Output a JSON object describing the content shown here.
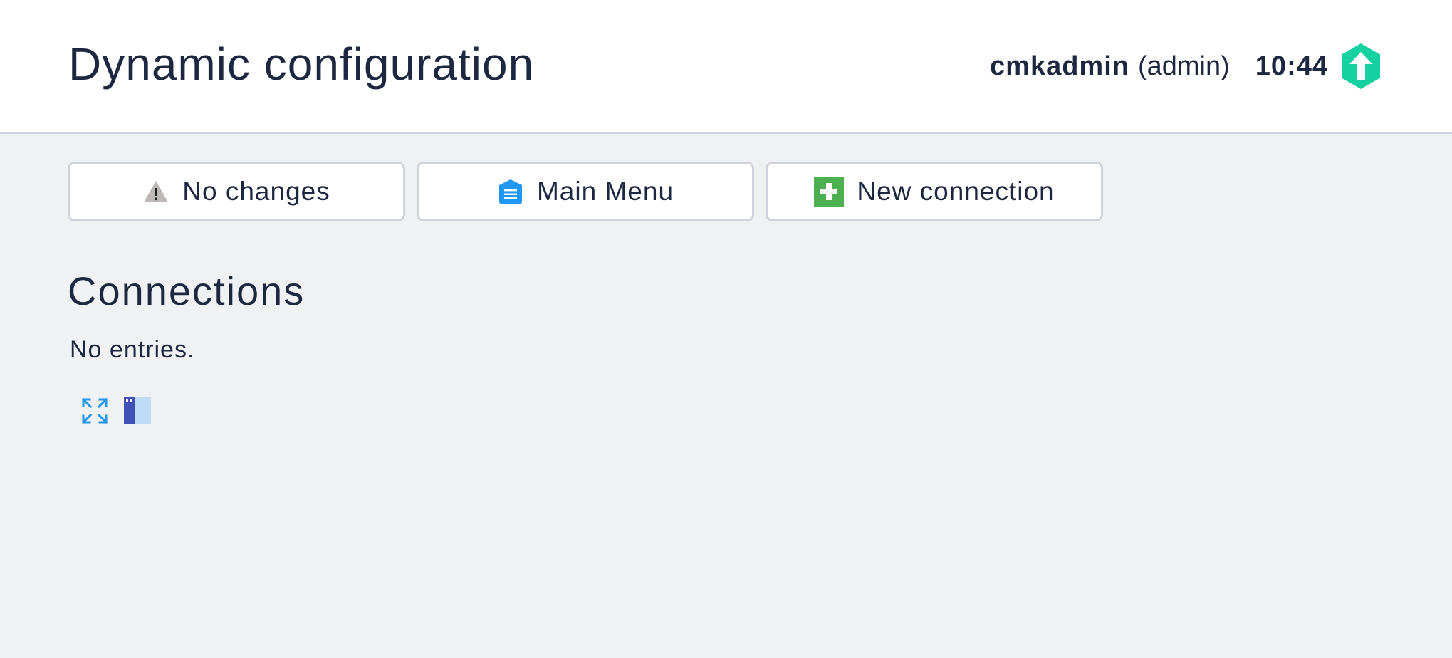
{
  "header": {
    "title": "Dynamic configuration",
    "user": {
      "name": "cmkadmin",
      "role": "(admin)"
    },
    "time": "10:44",
    "status_icon": "checkmk-update-icon"
  },
  "toolbar": {
    "buttons": [
      {
        "label": "No changes",
        "icon": "warning-icon"
      },
      {
        "label": "Main Menu",
        "icon": "main-menu-icon"
      },
      {
        "label": "New connection",
        "icon": "add-icon"
      }
    ]
  },
  "connections": {
    "heading": "Connections",
    "empty_message": "No entries."
  },
  "table_tools": [
    {
      "icon": "fullscreen-icon"
    },
    {
      "icon": "column-view-icon"
    }
  ],
  "colors": {
    "accent_blue": "#2196f3",
    "add_green": "#4caf50",
    "logo_green": "#15d1a0",
    "text": "#1e2740",
    "background": "#f0f1f3"
  }
}
